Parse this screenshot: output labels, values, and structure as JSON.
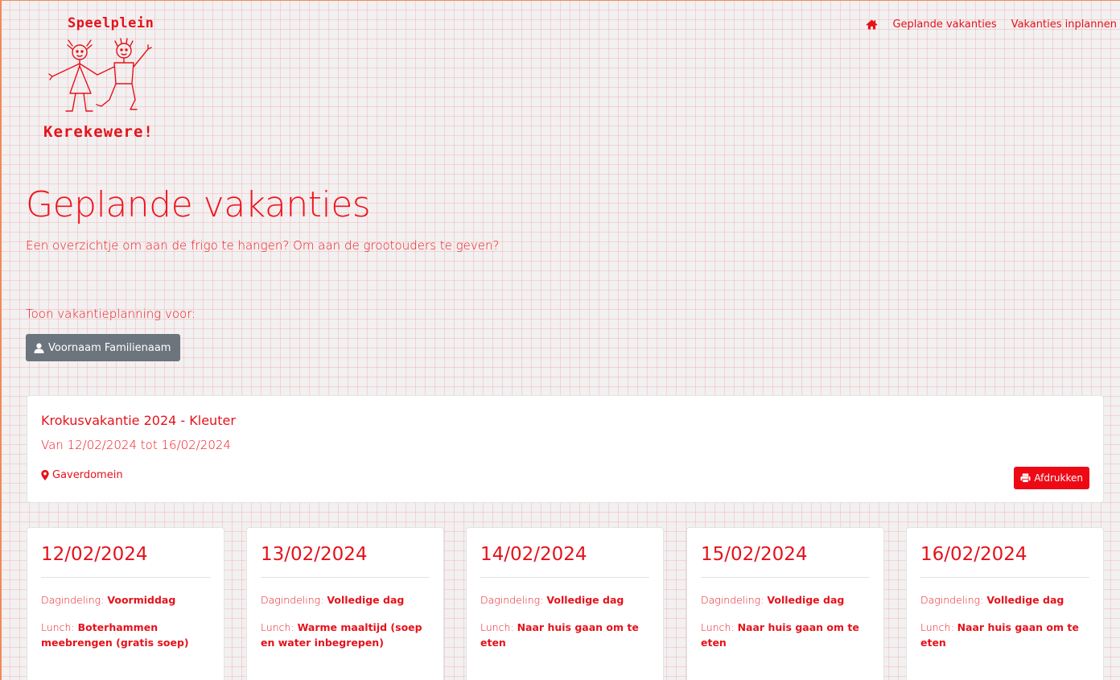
{
  "logo": {
    "top_text": "Speelplein",
    "bottom_text": "Kerekewere!",
    "icon": "children-drawing-icon"
  },
  "nav": {
    "home_icon": "home-icon",
    "links": [
      {
        "label": "Geplande vakanties"
      },
      {
        "label": "Vakanties inplannen"
      }
    ]
  },
  "page": {
    "title": "Geplande vakanties",
    "subtitle": "Een overzichtje om aan de frigo te hangen? Om aan de grootouders te geven?",
    "show_label": "Toon vakantieplanning voor:",
    "child_button_label": "Voornaam Familienaam",
    "child_button_icon": "user-icon"
  },
  "holiday": {
    "title": "Krokusvakantie 2024 - Kleuter",
    "dates": "Van 12/02/2024 tot 16/02/2024",
    "location": "Gaverdomein",
    "location_icon": "map-marker-icon",
    "print_label": "Afdrukken",
    "print_icon": "printer-icon"
  },
  "days": [
    {
      "date": "12/02/2024",
      "schedule_label": "Dagindeling:",
      "schedule": "Voormiddag",
      "lunch_label": "Lunch:",
      "lunch": "Boterhammen meebrengen (gratis soep)"
    },
    {
      "date": "13/02/2024",
      "schedule_label": "Dagindeling:",
      "schedule": "Volledige dag",
      "lunch_label": "Lunch:",
      "lunch": "Warme maaltijd (soep en water inbegrepen)"
    },
    {
      "date": "14/02/2024",
      "schedule_label": "Dagindeling:",
      "schedule": "Volledige dag",
      "lunch_label": "Lunch:",
      "lunch": "Naar huis gaan om te eten"
    },
    {
      "date": "15/02/2024",
      "schedule_label": "Dagindeling:",
      "schedule": "Volledige dag",
      "lunch_label": "Lunch:",
      "lunch": "Naar huis gaan om te eten"
    },
    {
      "date": "16/02/2024",
      "schedule_label": "Dagindeling:",
      "schedule": "Volledige dag",
      "lunch_label": "Lunch:",
      "lunch": "Naar huis gaan om te eten"
    }
  ],
  "colors": {
    "accent": "#e5121b",
    "print_button": "#ee0a14",
    "child_button": "#6c757d",
    "background": "#f2f0f0",
    "card": "#ffffff"
  }
}
